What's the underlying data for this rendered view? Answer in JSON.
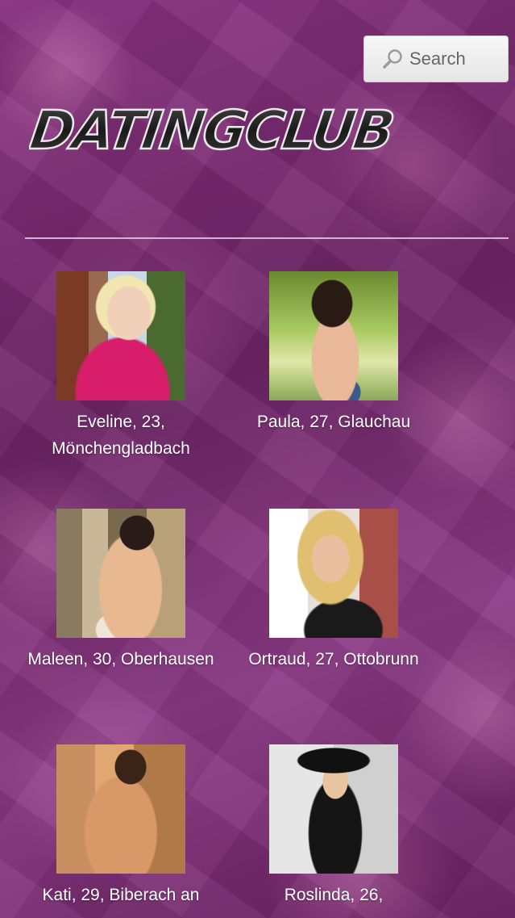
{
  "search": {
    "label": "Search"
  },
  "logo": {
    "text": "DATINGCLUB"
  },
  "profiles": [
    {
      "caption": "Eveline, 23, Mönchengladbach"
    },
    {
      "caption": "Paula, 27, Glauchau"
    },
    {
      "caption": "Maleen, 30, Oberhausen"
    },
    {
      "caption": "Ortraud, 27, Ottobrunn"
    },
    {
      "caption": "Kati, 29, Biberach an"
    },
    {
      "caption": "Roslinda, 26,"
    }
  ],
  "colors": {
    "background": "#7a2a74",
    "text": "#ffffff",
    "divider": "#ebc8e6"
  },
  "icons": {
    "search": "magnifier-icon"
  }
}
